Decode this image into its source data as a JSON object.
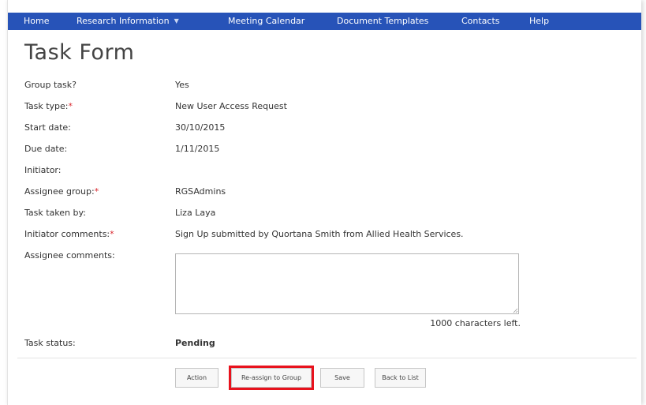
{
  "nav": {
    "items": [
      {
        "label": "Home"
      },
      {
        "label": "Research Information"
      },
      {
        "label": "Meeting Calendar"
      },
      {
        "label": "Document Templates"
      },
      {
        "label": "Contacts"
      },
      {
        "label": "Help"
      }
    ],
    "dropdown_icon": "chevron-down-icon"
  },
  "page_title": "Task Form",
  "fields": {
    "group_task": {
      "label": "Group task?",
      "value": "Yes"
    },
    "task_type": {
      "label": "Task type:",
      "required_mark": "*",
      "value": "New User Access Request"
    },
    "start_date": {
      "label": "Start date:",
      "value": "30/10/2015"
    },
    "due_date": {
      "label": "Due date:",
      "value": "1/11/2015"
    },
    "initiator": {
      "label": "Initiator:",
      "value": ""
    },
    "assignee_group": {
      "label": "Assignee group:",
      "required_mark": "*",
      "value": "RGSAdmins"
    },
    "task_taken_by": {
      "label": "Task taken by:",
      "value": "Liza Laya"
    },
    "initiator_comments": {
      "label": "Initiator comments:",
      "required_mark": "*",
      "value": "Sign Up submitted by Quortana Smith from Allied Health Services."
    },
    "assignee_comments": {
      "label": "Assignee comments:",
      "value": "",
      "chars_left": "1000 characters left."
    },
    "task_status": {
      "label": "Task status:",
      "value": "Pending"
    }
  },
  "buttons": {
    "action": "Action",
    "reassign": "Re-assign to Group",
    "save": "Save",
    "back": "Back to List"
  },
  "colors": {
    "nav_bg": "#2753b8",
    "required": "#d9282f",
    "highlight": "#e8121d"
  }
}
